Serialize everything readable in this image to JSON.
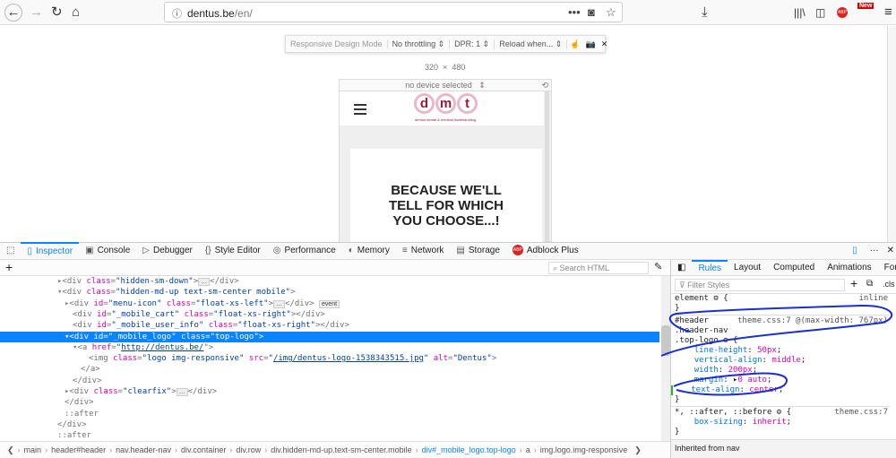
{
  "browser": {
    "url_host": "dentus.be",
    "url_path": "/en/",
    "new_badge": "New"
  },
  "rdm": {
    "title": "Responsive Design Mode",
    "throttling": "No throttling",
    "dpr": "DPR: 1",
    "reload": "Reload when...",
    "width": "320",
    "times": "×",
    "height": "480",
    "device": "no device selected"
  },
  "page": {
    "logo_letters": [
      "d",
      "m",
      "t"
    ],
    "tagline": "dentus dental & medical tradehandling",
    "hero": [
      "BECAUSE WE'LL",
      "TELL FOR WHICH",
      "YOU CHOOSE...!"
    ]
  },
  "devtools": {
    "tabs": [
      "Inspector",
      "Console",
      "Debugger",
      "Style Editor",
      "Performance",
      "Memory",
      "Network",
      "Storage",
      "Adblock Plus"
    ],
    "search_placeholder": "Search HTML",
    "markup": {
      "l0": {
        "tag": "<div ",
        "a1": "class",
        "v1": "\"hidden-sm-down\"",
        "end": ">",
        "close": "</div>"
      },
      "l1": {
        "tag": "<div ",
        "a1": "class",
        "v1": "\"hidden-md-up text-sm-center mobile\"",
        "end": ">"
      },
      "l2": {
        "tag": "<div ",
        "a1": "id",
        "v1": "\"menu-icon\"",
        "a2": "class",
        "v2": "\"float-xs-left\"",
        "end": ">",
        "close": "</div>",
        "badge": "event"
      },
      "l3": {
        "tag": "<div ",
        "a1": "id",
        "v1": "\"_mobile_cart\"",
        "a2": "class",
        "v2": "\"float-xs-right\"",
        "end": "></div>"
      },
      "l4": {
        "tag": "<div ",
        "a1": "id",
        "v1": "\"_mobile_user_info\"",
        "a2": "class",
        "v2": "\"float-xs-right\"",
        "end": "></div>"
      },
      "l5": {
        "tag": "<div ",
        "a1": "id",
        "v1": "\"_mobile_logo\"",
        "a2": "class",
        "v2": "\"top-logo\"",
        "end": ">"
      },
      "l6": {
        "tag": "<a ",
        "a1": "href",
        "q": "\"",
        "link": "http://dentus.be/",
        "end": "\">"
      },
      "l7": {
        "tag": "<img ",
        "a1": "class",
        "v1": "\"logo img-responsive\"",
        "a2": "src",
        "link": "/img/dentus-logo-1538343515.jpg",
        "a3": "alt",
        "v3": "\"Dentus\"",
        "end": ">"
      },
      "l8": "</a>",
      "l9": "</div>",
      "l10": {
        "tag": "<div ",
        "a1": "class",
        "v1": "\"clearfix\"",
        "end": ">",
        "close": "</div>"
      },
      "l11": "</div>",
      "l12": "::after",
      "l13": "</div>",
      "l14": "::after"
    },
    "breadcrumbs": [
      "main",
      "header#header",
      "nav.header-nav",
      "div.container",
      "div.row",
      "div.hidden-md-up.text-sm-center.mobile",
      "div#_mobile_logo.top-logo",
      "a",
      "img.logo.img-responsive"
    ],
    "side_tabs": [
      "Rules",
      "Layout",
      "Computed",
      "Animations",
      "Fonts"
    ],
    "filter_placeholder": "Filter Styles",
    "cls": ".cls",
    "rules": {
      "element": "element",
      "inline": "inline",
      "sel1": "#header",
      "sel2": ".header-nav",
      "sel3": ".top-logo",
      "source1": "theme.css:7 @(max-width: 767px)",
      "decls": [
        {
          "p": "line-height",
          "v": "50px"
        },
        {
          "p": "vertical-align",
          "v": "middle"
        },
        {
          "p": "width",
          "v": "200px"
        },
        {
          "p": "margin",
          "v": "0 auto"
        },
        {
          "p": "text-align",
          "v": "center"
        }
      ],
      "sel4": "*, ::after, ::before",
      "source2": "theme.css:7",
      "decl2": {
        "p": "box-sizing",
        "v": "inherit"
      },
      "inherited": "Inherited from nav"
    }
  }
}
